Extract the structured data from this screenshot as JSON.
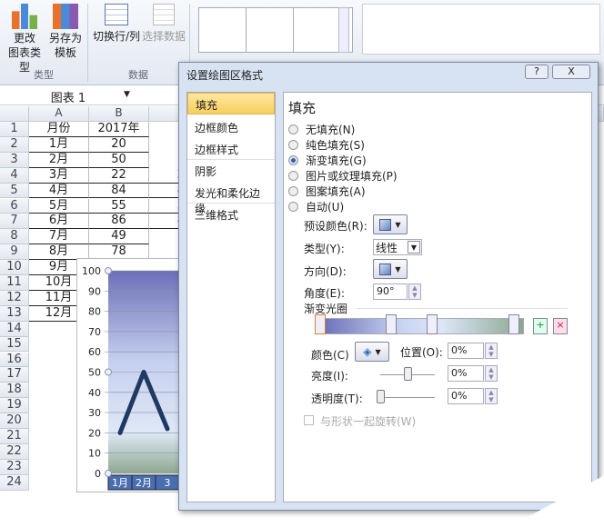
{
  "ribbon": {
    "change_chart_type": "更改\n图表类型",
    "change_chart_type_l1": "更改",
    "change_chart_type_l2": "图表类型",
    "save_template_l1": "另存为",
    "save_template_l2": "模板",
    "switch_row_col": "切换行/列",
    "select_data": "选择数据",
    "group_type": "类型",
    "group_data": "数据"
  },
  "namebox": {
    "value": "图表 1"
  },
  "sheet": {
    "columns": [
      "A",
      "B"
    ],
    "rows": [
      "1",
      "2",
      "3",
      "4",
      "5",
      "6",
      "7",
      "8",
      "9",
      "10",
      "11",
      "12",
      "13",
      "14",
      "15",
      "16",
      "17",
      "18",
      "19",
      "20",
      "21",
      "22",
      "23",
      "24"
    ],
    "colA": [
      "月份",
      "1月",
      "2月",
      "3月",
      "4月",
      "5月",
      "6月",
      "7月",
      "8月",
      "9月",
      "10月",
      "11月",
      "12月"
    ],
    "colB": [
      "2017年",
      "20",
      "50",
      "22",
      "84",
      "55",
      "86",
      "49",
      "78"
    ],
    "colC_partial": [
      "",
      "",
      "",
      "2",
      "8",
      "5",
      "8"
    ]
  },
  "chart_data": {
    "type": "line",
    "categories": [
      "1月",
      "2月",
      "3"
    ],
    "values": [
      20,
      50,
      22
    ],
    "ylim": [
      0,
      100
    ],
    "yticks": [
      "0",
      "10",
      "20",
      "30",
      "40",
      "50",
      "60",
      "70",
      "80",
      "90",
      "100"
    ],
    "grid": true,
    "line_color": "#1f3864"
  },
  "dialog": {
    "title": "设置绘图区格式",
    "help": "?",
    "close": "X",
    "nav": [
      "填充",
      "边框颜色",
      "边框样式",
      "阴影",
      "发光和柔化边缘",
      "三维格式"
    ],
    "panel_title": "填充",
    "fill_options": [
      "无填充(N)",
      "纯色填充(S)",
      "渐变填充(G)",
      "图片或纹理填充(P)",
      "图案填充(A)",
      "自动(U)"
    ],
    "selected_fill": "渐变填充(G)",
    "preset_label": "预设颜色(R):",
    "type_label": "类型(Y):",
    "type_value": "线性",
    "direction_label": "方向(D):",
    "angle_label": "角度(E):",
    "angle_value": "90°",
    "stops_label": "渐变光圈",
    "color_label": "颜色(C)",
    "position_label": "位置(O):",
    "position_value": "0%",
    "brightness_label": "亮度(I):",
    "brightness_value": "0%",
    "transparency_label": "透明度(T):",
    "transparency_value": "0%",
    "rotate_label": "与形状一起旋转(W)",
    "gradient_stops_pct": [
      0,
      35,
      55,
      95
    ],
    "brightness_slider": 0.5,
    "transparency_slider": 0
  }
}
